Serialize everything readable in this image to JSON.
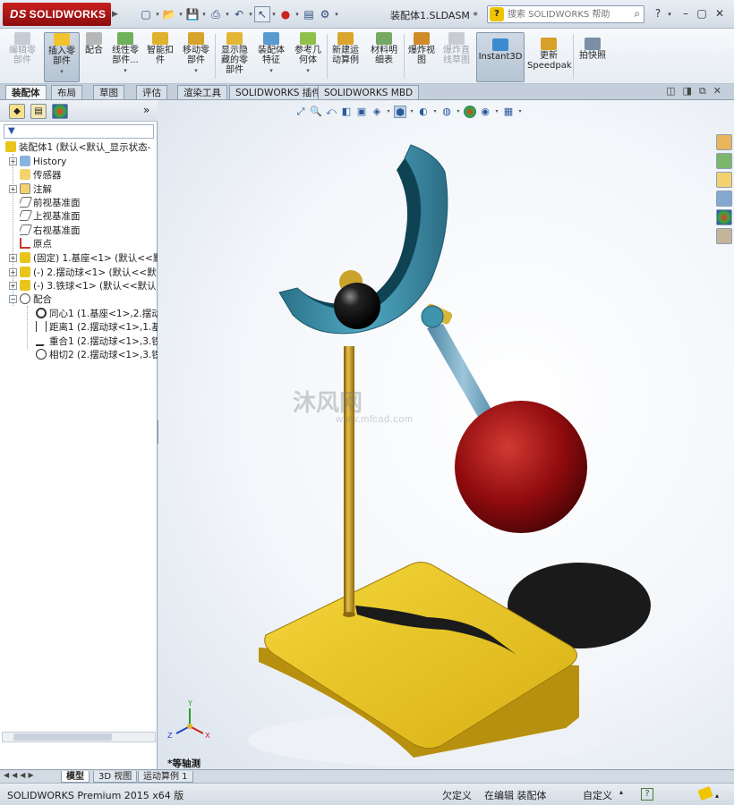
{
  "app": {
    "logo_text": "SOLIDWORKS",
    "document_title": "装配体1.SLDASM *",
    "search_placeholder": "搜索 SOLIDWORKS 帮助"
  },
  "quick_access": [
    {
      "name": "new-document-icon"
    },
    {
      "name": "open-file-icon"
    },
    {
      "name": "save-icon"
    },
    {
      "name": "print-icon"
    },
    {
      "name": "undo-icon"
    },
    {
      "name": "select-cursor-icon"
    },
    {
      "name": "rebuild-traffic-light-icon"
    },
    {
      "name": "file-properties-icon"
    },
    {
      "name": "options-icon"
    }
  ],
  "command_manager": [
    {
      "label": "编辑零部件",
      "icon": "edit-component-icon",
      "disabled": true
    },
    {
      "label": "插入零部件",
      "icon": "insert-component-icon",
      "disabled": false
    },
    {
      "label": "配合",
      "icon": "mate-icon",
      "disabled": false
    },
    {
      "label": "线性零部件...",
      "icon": "linear-pattern-icon",
      "disabled": false
    },
    {
      "label": "智能扣件",
      "icon": "smart-fasteners-icon",
      "disabled": false
    },
    {
      "label": "移动零部件",
      "icon": "move-component-icon",
      "disabled": false
    },
    {
      "label": "显示隐藏的零部件",
      "icon": "show-hidden-icon",
      "disabled": false
    },
    {
      "label": "装配体特征",
      "icon": "assembly-features-icon",
      "disabled": false
    },
    {
      "label": "参考几何体",
      "icon": "reference-geometry-icon",
      "disabled": false
    },
    {
      "label": "新建运动算例",
      "icon": "new-motion-study-icon",
      "disabled": false
    },
    {
      "label": "材料明细表",
      "icon": "bill-of-materials-icon",
      "disabled": false
    },
    {
      "label": "爆炸视图",
      "icon": "exploded-view-icon",
      "disabled": false
    },
    {
      "label": "爆炸直线草图",
      "icon": "explode-line-sketch-icon",
      "disabled": true
    },
    {
      "label": "Instant3D",
      "icon": "instant3d-icon",
      "disabled": false
    },
    {
      "label": "更新Speedpak",
      "icon": "speedpak-icon",
      "disabled": false
    },
    {
      "label": "拍快照",
      "icon": "snapshot-icon",
      "disabled": false
    }
  ],
  "tabs": [
    "装配体",
    "布局",
    "草图",
    "评估",
    "渲染工具",
    "SOLIDWORKS 插件",
    "SOLIDWORKS MBD"
  ],
  "active_tab": "装配体",
  "tree": {
    "root": "装配体1  (默认<默认_显示状态-",
    "items": [
      {
        "label": "History",
        "icon": "history-icon"
      },
      {
        "label": "传感器",
        "icon": "sensors-icon"
      },
      {
        "label": "注解",
        "icon": "annotations-icon"
      },
      {
        "label": "前视基准面",
        "icon": "plane-icon"
      },
      {
        "label": "上视基准面",
        "icon": "plane-icon"
      },
      {
        "label": "右视基准面",
        "icon": "plane-icon"
      },
      {
        "label": "原点",
        "icon": "origin-icon"
      },
      {
        "label": "(固定) 1.基座<1> (默认<<默",
        "icon": "part-icon"
      },
      {
        "label": "(-) 2.摆动球<1> (默认<<默",
        "icon": "part-icon"
      },
      {
        "label": "(-) 3.铁球<1> (默认<<默认",
        "icon": "part-icon"
      },
      {
        "label": "配合",
        "icon": "mates-folder-icon"
      },
      {
        "label": "同心1 (1.基座<1>,2.摆动",
        "icon": "concentric-icon"
      },
      {
        "label": "距离1 (2.摆动球<1>,1.基",
        "icon": "distance-icon"
      },
      {
        "label": "重合1 (2.摆动球<1>,3.铁",
        "icon": "coincident-icon"
      },
      {
        "label": "相切2 (2.摆动球<1>,3.铁",
        "icon": "tangent-icon"
      }
    ]
  },
  "viewport": {
    "view_name": "*等轴测",
    "watermark_main": "沐风网",
    "watermark_sub": "www.mfcad.com",
    "colors": {
      "base_yellow": "#e8c51b",
      "post_gold": "#c79a1a",
      "cradle_teal": "#3a8fa8",
      "sphere_red": "#9a0d10",
      "arm_blue": "#6b9fb9",
      "ball_black": "#111111"
    }
  },
  "bottom_tabs": [
    "模型",
    "3D 视图",
    "运动算例 1"
  ],
  "status": {
    "product": "SOLIDWORKS Premium 2015 x64 版",
    "under_defined": "欠定义",
    "editing": "在编辑 装配体",
    "custom": "自定义"
  }
}
